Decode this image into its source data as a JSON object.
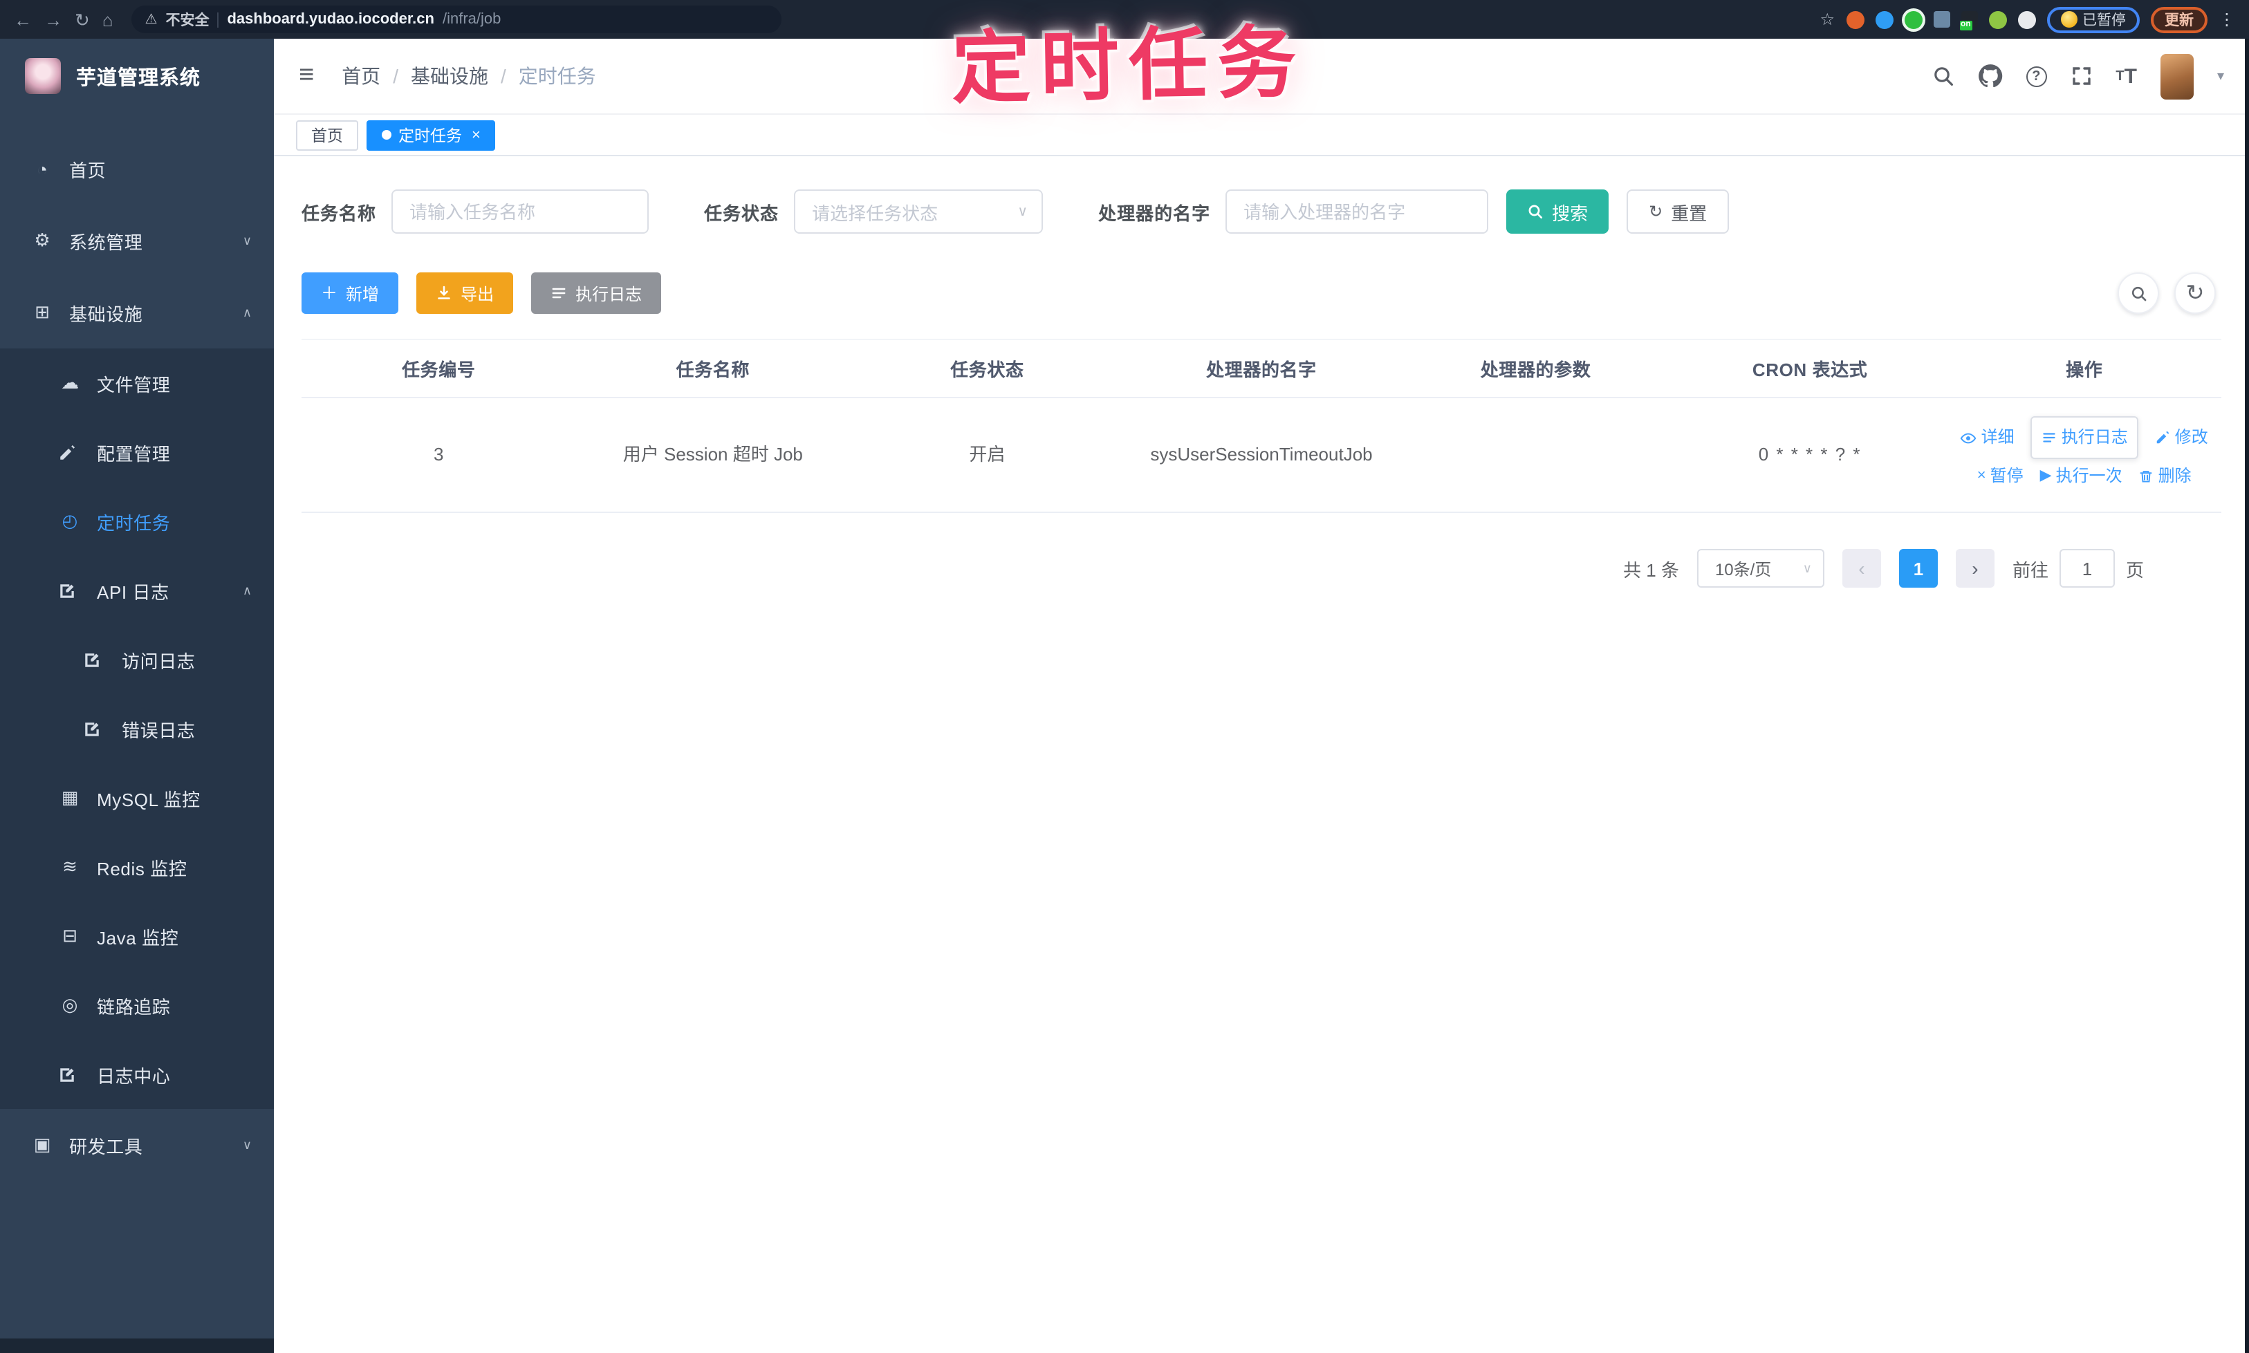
{
  "colors": {
    "accent_blue": "#409eff",
    "tab_active_blue": "#1890ff",
    "search_teal": "#2bb7a2",
    "export_orange": "#f2a31d",
    "log_grey": "#909399",
    "sidebar_bg": "#304156",
    "sidebar_sub_bg": "#263548",
    "browser_bar_bg": "#1d2634",
    "watermark_pink": "#ee3a64",
    "pager_active_blue": "#2a9cf6"
  },
  "icons": {
    "back": "left-arrow",
    "forward": "right-arrow",
    "reload": "circular-arrow",
    "home": "house",
    "warning": "triangle-exclamation",
    "star": "bookmark-star",
    "kebab": "vertical-dots",
    "search": "magnifier",
    "github": "octocat",
    "help": "question-circle",
    "fullscreen": "expand-arrows",
    "font-size": "tT",
    "caret": "down-triangle",
    "hamburger": "three-lines",
    "add": "plus",
    "export": "download-arrow",
    "refresh": "circular-arrow",
    "detail": "eye",
    "log": "list-lines",
    "edit": "pencil",
    "pause": "cross",
    "run": "play-triangle",
    "delete": "trash"
  },
  "watermark_text": "定时任务",
  "browser": {
    "warning_text": "不安全",
    "url_host": "dashboard.yudao.iocoder.cn",
    "url_path": "/infra/job",
    "ext_badge": "on",
    "profile_status": "已暂停",
    "update_label": "更新"
  },
  "sidebar": {
    "app_title": "芋道管理系统",
    "items": [
      {
        "label": "首页"
      },
      {
        "label": "系统管理"
      },
      {
        "label": "基础设施"
      },
      {
        "label": "文件管理"
      },
      {
        "label": "配置管理"
      },
      {
        "label": "定时任务"
      },
      {
        "label": "API 日志"
      },
      {
        "label": "访问日志"
      },
      {
        "label": "错误日志"
      },
      {
        "label": "MySQL 监控"
      },
      {
        "label": "Redis 监控"
      },
      {
        "label": "Java 监控"
      },
      {
        "label": "链路追踪"
      },
      {
        "label": "日志中心"
      },
      {
        "label": "研发工具"
      }
    ]
  },
  "navbar": {
    "breadcrumb": {
      "home": "首页",
      "section": "基础设施",
      "current": "定时任务"
    }
  },
  "tabs": {
    "home": "首页",
    "active": "定时任务",
    "close": "×"
  },
  "filters": {
    "name_label": "任务名称",
    "name_placeholder": "请输入任务名称",
    "status_label": "任务状态",
    "status_placeholder": "请选择任务状态",
    "handler_label": "处理器的名字",
    "handler_placeholder": "请输入处理器的名字",
    "search_label": "搜索",
    "reset_label": "重置"
  },
  "toolbar": {
    "add_label": "新增",
    "export_label": "导出",
    "joblog_label": "执行日志"
  },
  "table": {
    "headers": [
      "任务编号",
      "任务名称",
      "任务状态",
      "处理器的名字",
      "处理器的参数",
      "CRON 表达式",
      "操作"
    ],
    "row": {
      "id": "3",
      "name": "用户 Session 超时 Job",
      "status": "开启",
      "handler": "sysUserSessionTimeoutJob",
      "param": "",
      "cron": "0 * * * * ? *",
      "ops_line1": [
        {
          "label": "详细"
        },
        {
          "label": "执行日志"
        },
        {
          "label": "修改"
        }
      ],
      "ops_line2": [
        {
          "label": "暂停"
        },
        {
          "label": "执行一次"
        },
        {
          "label": "删除"
        }
      ]
    }
  },
  "pagination": {
    "total": "共 1 条",
    "page_size": "10条/页",
    "current_page": "1",
    "goto_label": "前往",
    "goto_value": "1",
    "page_unit": "页"
  }
}
